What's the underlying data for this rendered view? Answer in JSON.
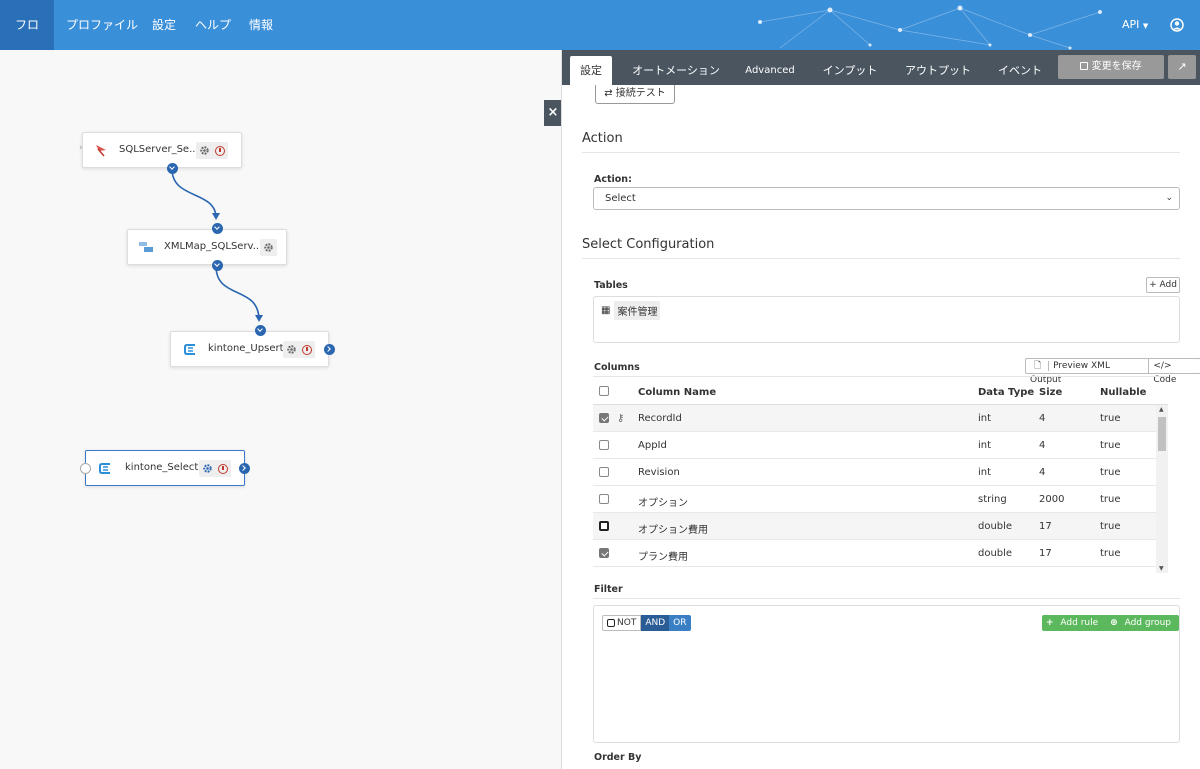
{
  "nav": {
    "items": [
      "フロー",
      "プロファイル",
      "設定",
      "ヘルプ",
      "情報"
    ],
    "api_label": "API",
    "account_icon": "user-circle-icon"
  },
  "canvas": {
    "nodes": [
      {
        "label": "SQLServer_Se...",
        "icon": "sqlserver-icon"
      },
      {
        "label": "XMLMap_SQLServ...",
        "icon": "xmlmap-icon"
      },
      {
        "label": "kintone_Upsert",
        "icon": "kintone-icon"
      },
      {
        "label": "kintone_Select",
        "icon": "kintone-icon"
      }
    ],
    "close_label": "×"
  },
  "panel": {
    "tabs": [
      "設定",
      "オートメーション",
      "Advanced",
      "インプット",
      "アウトプット",
      "イベント"
    ],
    "save_label": "変更を保存",
    "conn_test_label": "接続テスト",
    "action_heading": "Action",
    "action_label": "Action:",
    "action_value": "Select",
    "select_config_heading": "Select Configuration",
    "tables_label": "Tables",
    "add_label": "+ Add",
    "table_name": "案件管理",
    "columns_label": "Columns",
    "preview_label": "Preview XML Output",
    "code_label": "</> Code",
    "col_headers": {
      "name": "Column Name",
      "type": "Data Type",
      "size": "Size",
      "nullable": "Nullable"
    },
    "columns": [
      {
        "checked": true,
        "key": true,
        "name": "RecordId",
        "type": "int",
        "size": "4",
        "nullable": "true"
      },
      {
        "checked": false,
        "key": false,
        "name": "AppId",
        "type": "int",
        "size": "4",
        "nullable": "true"
      },
      {
        "checked": false,
        "key": false,
        "name": "Revision",
        "type": "int",
        "size": "4",
        "nullable": "true"
      },
      {
        "checked": false,
        "key": false,
        "name": "オプション",
        "type": "string",
        "size": "2000",
        "nullable": "true"
      },
      {
        "checked": false,
        "key": false,
        "name": "オプション費用",
        "type": "double",
        "size": "17",
        "nullable": "true"
      },
      {
        "checked": true,
        "key": false,
        "name": "プラン費用",
        "type": "double",
        "size": "17",
        "nullable": "true"
      }
    ],
    "filter_label": "Filter",
    "not_label": "NOT",
    "and_label": "AND",
    "or_label": "OR",
    "add_rule_label": "Add rule",
    "add_group_label": "Add group",
    "order_by_label": "Order By"
  },
  "colors": {
    "nav_bg": "#3a8fd9",
    "nav_active": "#2a70b8",
    "tab_bar": "#4a5560",
    "port": "#2a67b0",
    "rule_green": "#5cb85c"
  }
}
